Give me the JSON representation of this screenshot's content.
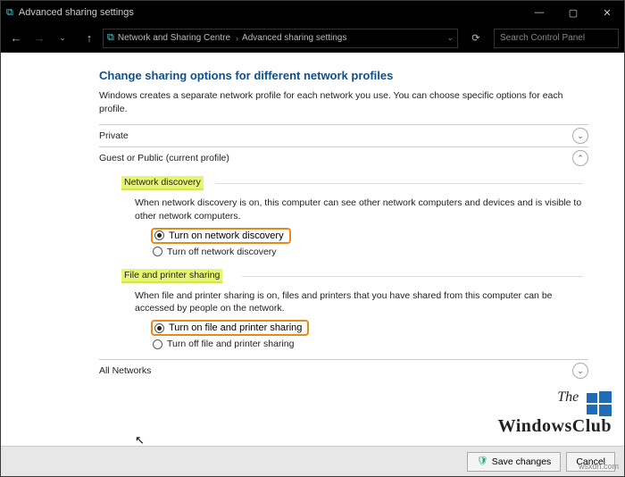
{
  "window": {
    "title": "Advanced sharing settings"
  },
  "toolbar": {
    "breadcrumb1": "Network and Sharing Centre",
    "breadcrumb2": "Advanced sharing settings",
    "search_placeholder": "Search Control Panel"
  },
  "page": {
    "heading": "Change sharing options for different network profiles",
    "intro": "Windows creates a separate network profile for each network you use. You can choose specific options for each profile."
  },
  "sections": {
    "private": "Private",
    "guest": "Guest or Public (current profile)",
    "all": "All Networks"
  },
  "netdisc": {
    "title": "Network discovery",
    "desc": "When network discovery is on, this computer can see other network computers and devices and is visible to other network computers.",
    "on": "Turn on network discovery",
    "off": "Turn off network discovery"
  },
  "fps": {
    "title": "File and printer sharing",
    "desc": "When file and printer sharing is on, files and printers that you have shared from this computer can be accessed by people on the network.",
    "on": "Turn on file and printer sharing",
    "off": "Turn off file and printer sharing"
  },
  "buttons": {
    "save": "Save changes",
    "cancel": "Cancel"
  },
  "watermark": {
    "line1": "The",
    "line2": "WindowsClub",
    "url": "wsxdn.com"
  }
}
